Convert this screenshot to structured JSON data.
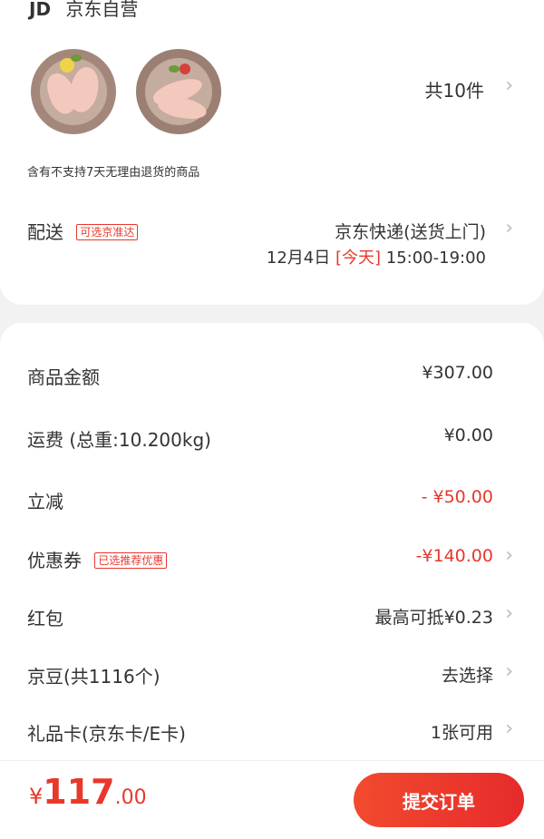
{
  "store": {
    "logo": "JD",
    "name": "京东自营"
  },
  "products": {
    "count": "共10件",
    "policy_note": "含有不支持7天无理由退货的商品"
  },
  "delivery": {
    "label": "配送",
    "badge": "可选京准达",
    "method": "京东快递(送货上门)",
    "date": "12月4日",
    "today_tag": "[今天]",
    "time": "15:00-19:00"
  },
  "fees": [
    {
      "label": "商品金额",
      "value": "¥307.00",
      "value_red": false,
      "badge": ""
    },
    {
      "label": "运费 (总重:10.200kg)",
      "value": "¥0.00",
      "value_red": false,
      "badge": ""
    },
    {
      "label": "立减",
      "value": "- ¥50.00",
      "value_red": true,
      "badge": ""
    },
    {
      "label": "优惠券",
      "value": "-¥140.00",
      "value_red": true,
      "badge": "已选推荐优惠"
    },
    {
      "label": "红包",
      "value": "最高可抵¥0.23",
      "value_red": false,
      "badge": ""
    },
    {
      "label": "京豆(共1116个)",
      "value": "去选择",
      "value_red": false,
      "badge": ""
    },
    {
      "label": "礼品卡(京东卡/E卡)",
      "value": "1张可用",
      "value_red": false,
      "badge": ""
    }
  ],
  "footer": {
    "currency": "¥",
    "total_int": "117",
    "total_dec": ".00",
    "submit_label": "提交订单"
  },
  "colors": {
    "accent": "#e8382c",
    "background": "#f2f2f2"
  }
}
